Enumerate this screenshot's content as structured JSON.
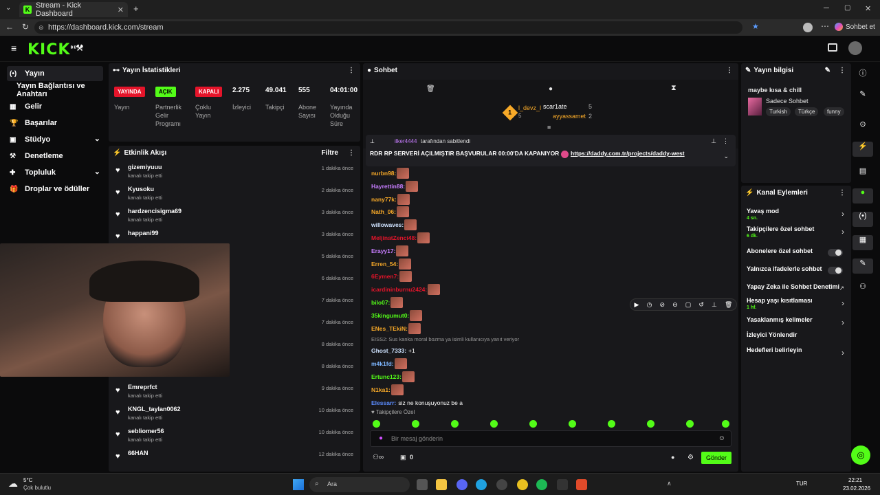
{
  "browser": {
    "tab_title": "Stream - Kick Dashboard",
    "url": "https://dashboard.kick.com/stream",
    "copilot_label": "Sohbet et"
  },
  "app": {
    "logo": "KICK",
    "logo_sup": "BETA"
  },
  "leftnav": [
    {
      "icon": "(•)",
      "label": "Yayın",
      "active": true
    },
    {
      "icon": "",
      "label": "Yayın Bağlantısı ve Anahtarı",
      "active": false
    },
    {
      "icon": "▦",
      "label": "Gelir",
      "active": false
    },
    {
      "icon": "🏆",
      "label": "Başarılar",
      "active": false
    },
    {
      "icon": "▣",
      "label": "Stüdyo",
      "active": false,
      "chevron": true
    },
    {
      "icon": "⚒",
      "label": "Denetleme",
      "active": false
    },
    {
      "icon": "✚",
      "label": "Topluluk",
      "active": false,
      "chevron": true
    },
    {
      "icon": "🎁",
      "label": "Droplar ve ödüller",
      "active": false
    }
  ],
  "stats": {
    "title": "Yayın İstatistikleri",
    "badges": [
      {
        "text": "YAYINDA",
        "label": "Yayın",
        "color": "#e5142a"
      },
      {
        "text": "AÇIK",
        "label": "Partnerlik Gelir Programı",
        "color": "#53fc18"
      },
      {
        "text": "KAPALI",
        "label": "Çoklu Yayın",
        "color": "#e5142a"
      }
    ],
    "numbers": [
      {
        "value": "2.275",
        "label": "İzleyici"
      },
      {
        "value": "49.041",
        "label": "Takipçi"
      },
      {
        "value": "555",
        "label": "Abone Sayısı"
      },
      {
        "value": "04:01:00",
        "label": "Yayında Olduğu Süre"
      }
    ]
  },
  "activity": {
    "title": "Etkinlik Akışı",
    "filter": "Filtre",
    "items": [
      {
        "name": "gizemiyuuu",
        "sub": "kanalı takip etti",
        "time": "1 dakika önce"
      },
      {
        "name": "Kyusoku",
        "sub": "kanalı takip etti",
        "time": "2 dakika önce"
      },
      {
        "name": "hardzencisigma69",
        "sub": "kanalı takip etti",
        "time": "3 dakika önce"
      },
      {
        "name": "happani99",
        "sub": "",
        "time": "3 dakika önce"
      },
      {
        "name": "",
        "sub": "",
        "time": "5 dakika önce"
      },
      {
        "name": "",
        "sub": "",
        "time": "6 dakika önce"
      },
      {
        "name": "",
        "sub": "",
        "time": "7 dakika önce"
      },
      {
        "name": "",
        "sub": "",
        "time": "7 dakika önce"
      },
      {
        "name": "",
        "sub": "",
        "time": "8 dakika önce"
      },
      {
        "name": "",
        "sub": "kanalı takip etti",
        "time": "8 dakika önce"
      },
      {
        "name": "Emreprfct",
        "sub": "kanalı takip etti",
        "time": "9 dakika önce"
      },
      {
        "name": "KNGL_taylan0062",
        "sub": "kanalı takip etti",
        "time": "10 dakika önce"
      },
      {
        "name": "sebliomer56",
        "sub": "kanalı takip etti",
        "time": "10 dakika önce"
      },
      {
        "name": "66HAN",
        "sub": "",
        "time": "12 dakika önce"
      }
    ]
  },
  "chat": {
    "title": "Sohbet",
    "leader1": "l_devz_l",
    "leader1_count": "5",
    "leader2": "scar1ate",
    "leader2_count": "5",
    "leader3": "ayyassamet",
    "leader3_count": "2",
    "rank": "1",
    "pin_user": "ilker4444",
    "pin_by": "tarafından sabitlendi",
    "pin_text": "RDR RP SERVERİ AÇILMIŞTIR BAŞVURULAR 00:00'DA KAPANIYOR",
    "pin_link": "https://daddy.com.tr/projects/daddy-west",
    "messages": [
      {
        "user": "nurbn98:",
        "color": "#f7a928",
        "text": "",
        "emote": true
      },
      {
        "user": "Hayrettin88:",
        "color": "#c77dff",
        "text": "",
        "emote": true
      },
      {
        "user": "nany77k:",
        "color": "#f7a928",
        "text": "",
        "emote": true
      },
      {
        "user": "Nath_06:",
        "color": "#f7a928",
        "text": "",
        "emote": true
      },
      {
        "user": "willowaves:",
        "color": "#cfe3ff",
        "text": "",
        "emote": true
      },
      {
        "user": "MeljinatZenci48:",
        "color": "#e5142a",
        "text": "",
        "emote": true
      },
      {
        "user": "Erayy17:",
        "color": "#c77dff",
        "text": "",
        "emote": true
      },
      {
        "user": "Erren_54:",
        "color": "#f7a928",
        "text": "",
        "emote": true
      },
      {
        "user": "6Eymen7:",
        "color": "#e5142a",
        "text": "",
        "emote": true
      },
      {
        "user": "icardininburnu2424:",
        "color": "#e5142a",
        "text": "",
        "emote": true
      },
      {
        "user": "bilo07:",
        "color": "#53fc18",
        "text": "",
        "emote": true
      },
      {
        "user": "35kingumut0:",
        "color": "#53fc18",
        "text": "",
        "emote": true
      },
      {
        "user": "ENes_TEkiN:",
        "color": "#f7a928",
        "text": "",
        "emote": true
      },
      {
        "user": "Ghost_7333:",
        "color": "#cfe3ff",
        "text": "+1",
        "emote": false
      },
      {
        "user": "m4k1fd:",
        "color": "#7db6ff",
        "text": "",
        "emote": true
      },
      {
        "user": "Ertunc123:",
        "color": "#53fc18",
        "text": "",
        "emote": true
      },
      {
        "user": "N1ka1:",
        "color": "#f7a928",
        "text": "",
        "emote": true
      },
      {
        "user": "Elessarr:",
        "color": "#5b8cff",
        "text": "siz ne konuşuyonuz be a",
        "emote": false
      }
    ],
    "reply_text": "EISS2: Sus kanka moral bozma ya isimli kullanıcıya yanıt veriyor",
    "followers_only": "Takipçilere Özel",
    "input_placeholder": "Bir mesaj gönderin",
    "send_label": "Gönder",
    "points": "0"
  },
  "info": {
    "title": "Yayın bilgisi",
    "stream_title": "maybe kısa & chill",
    "category": "Sadece Sohbet",
    "tags": [
      "Turkish",
      "Türkçe",
      "funny"
    ]
  },
  "actions": {
    "title": "Kanal Eylemleri",
    "items": [
      {
        "label": "Yavaş mod",
        "value": "4 sn.",
        "type": "chevron"
      },
      {
        "label": "Takipçilere özel sohbet",
        "value": "6 dk.",
        "type": "chevron"
      },
      {
        "label": "Abonelere özel sohbet",
        "value": "",
        "type": "toggle"
      },
      {
        "label": "Yalnızca ifadelerle sohbet",
        "value": "",
        "type": "toggle"
      },
      {
        "label": "Yapay Zeka ile Sohbet Denetimi",
        "value": "",
        "type": "icon"
      },
      {
        "label": "Hesap yaşı kısıtlaması",
        "value": "1 hf.",
        "type": "chevron"
      },
      {
        "label": "Yasaklanmış kelimeler",
        "value": "",
        "type": "chevron"
      },
      {
        "label": "İzleyici Yönlendir",
        "value": "",
        "type": "none"
      },
      {
        "label": "Hedefleri belirleyin",
        "value": "",
        "type": "chevron"
      }
    ]
  },
  "taskbar": {
    "weather_temp": "5°C",
    "weather_desc": "Çok bulutlu",
    "search": "Ara",
    "lang": "TUR",
    "time": "22:21",
    "date": "23.02.2026"
  }
}
